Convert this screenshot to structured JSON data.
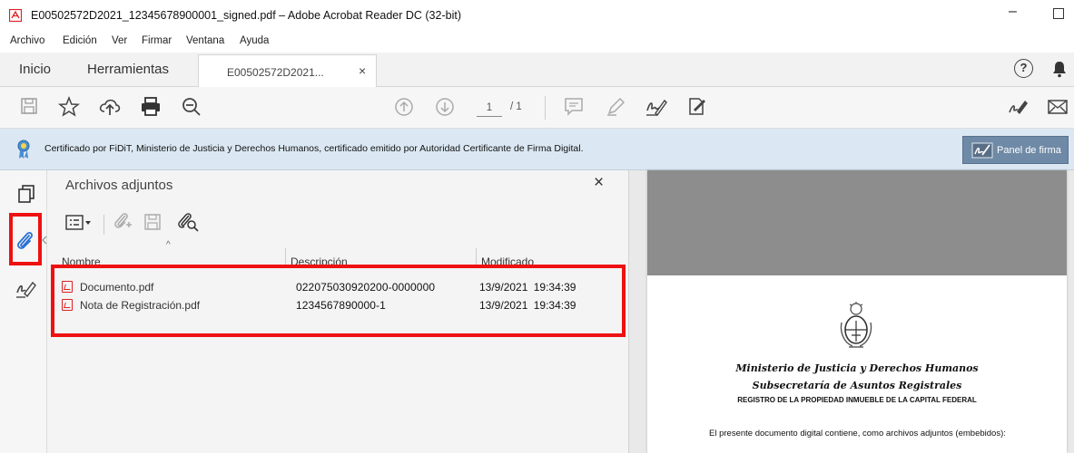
{
  "window": {
    "title": "E00502572D2021_12345678900001_signed.pdf – Adobe Acrobat Reader DC (32-bit)",
    "minimize_glyph": "–"
  },
  "menu": [
    "Archivo",
    "Edición",
    "Ver",
    "Firmar",
    "Ventana",
    "Ayuda"
  ],
  "tabs": {
    "home": "Inicio",
    "tools": "Herramientas",
    "document": "E00502572D2021...",
    "close_glyph": "×"
  },
  "toolbar": {
    "page_current": "1",
    "page_total": "/ 1"
  },
  "signature_bar": {
    "text": "Certificado por FiDiT, Ministerio de Justicia y Derechos Humanos, certificado emitido por Autoridad Certificante de Firma Digital.",
    "panel_button": "Panel de firma"
  },
  "attachments_panel": {
    "title": "Archivos adjuntos",
    "close_glyph": "×",
    "columns": [
      "Nombre",
      "Descripción",
      "Modificado"
    ],
    "files": [
      {
        "name": "Documento.pdf",
        "description": "022075030920200-0000000",
        "modified": "13/9/2021 19:34:39"
      },
      {
        "name": "Nota de Registración.pdf",
        "description": "1234567890000-1",
        "modified": "13/9/2021 19:34:39"
      }
    ]
  },
  "document_preview": {
    "ministry": "Ministerio de Justicia y Derechos Humanos",
    "undersecretariat": "Subsecretaría de Asuntos Registrales",
    "registry": "REGISTRO DE LA PROPIEDAD INMUEBLE DE LA CAPITAL FEDERAL",
    "body": "El presente documento digital contiene, como archivos adjuntos (embebidos):"
  },
  "colors": {
    "highlight": "#ee1111",
    "signature_bar_bg": "#dbe8f3",
    "panel_button_bg": "#6f8aa6",
    "pdf_red": "#dd2222"
  }
}
